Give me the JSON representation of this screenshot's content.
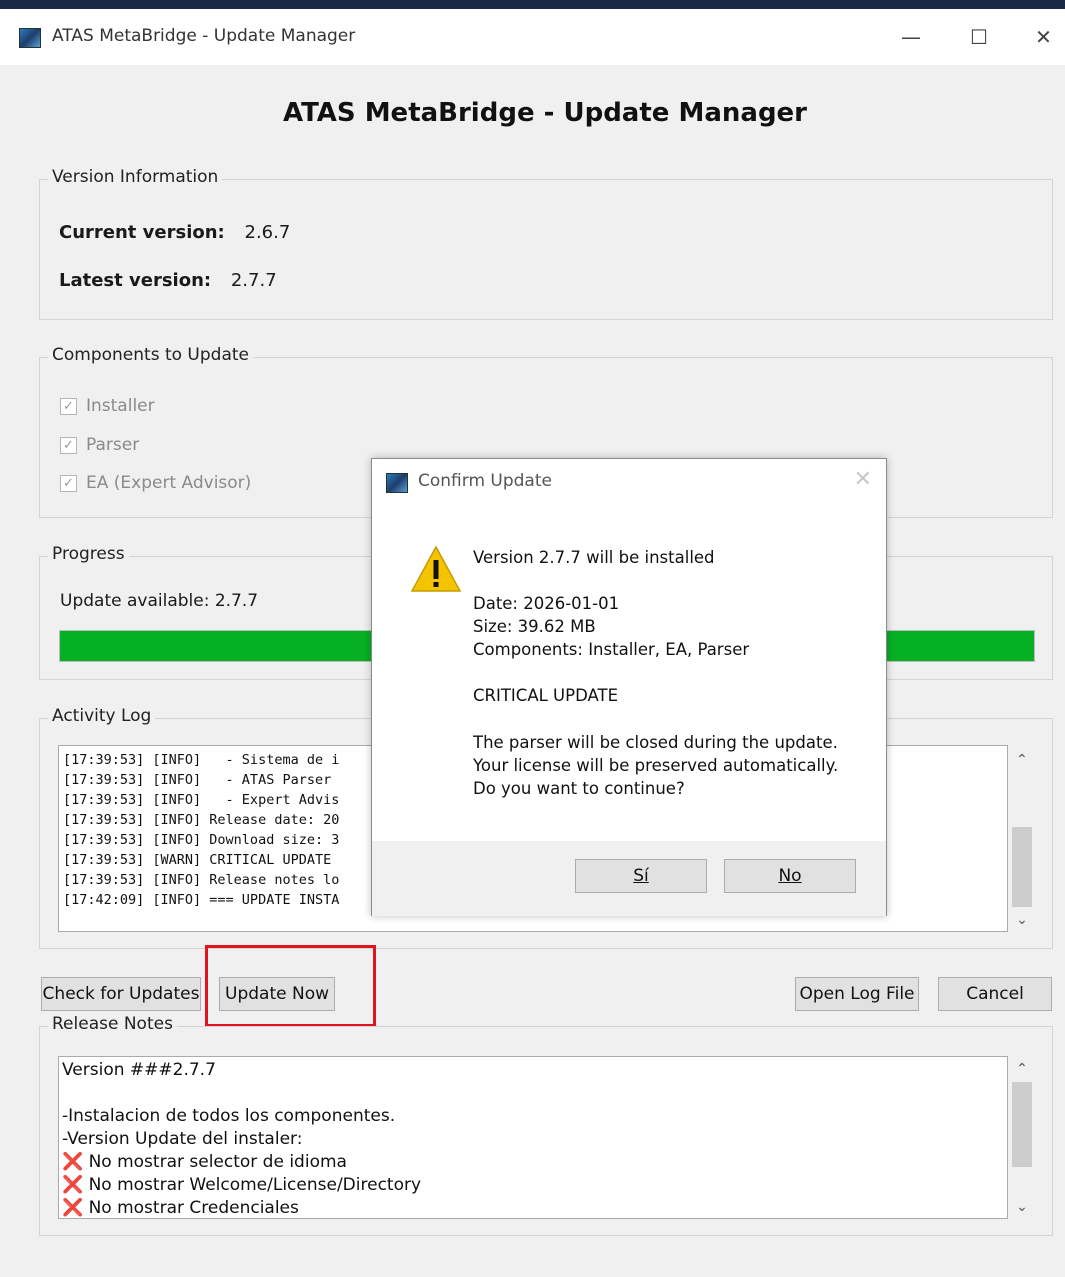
{
  "window": {
    "title": "ATAS MetaBridge - Update Manager",
    "minimize_glyph": "—",
    "maximize_glyph": "☐",
    "close_glyph": "✕"
  },
  "main_title": "ATAS MetaBridge - Update Manager",
  "version_info": {
    "group_label": "Version Information",
    "current_label": "Current version:",
    "current_value": "2.6.7",
    "latest_label": "Latest version:",
    "latest_value": "2.7.7"
  },
  "components": {
    "group_label": "Components to Update",
    "items": [
      {
        "label": "Installer",
        "checked": true
      },
      {
        "label": "Parser",
        "checked": true
      },
      {
        "label": "EA (Expert Advisor)",
        "checked": true
      }
    ]
  },
  "progress": {
    "group_label": "Progress",
    "status_text": "Update available: 2.7.7",
    "fraction": 1.0,
    "bar_color": "#06b025"
  },
  "activity_log": {
    "group_label": "Activity Log",
    "lines": [
      "[17:39:53] [INFO]   - Sistema de i",
      "[17:39:53] [INFO]   - ATAS Parser ",
      "[17:39:53] [INFO]   - Expert Advis",
      "[17:39:53] [INFO] Release date: 20",
      "[17:39:53] [INFO] Download size: 3",
      "[17:39:53] [WARN] CRITICAL UPDATE ",
      "[17:39:53] [INFO] Release notes lo",
      "[17:42:09] [INFO] === UPDATE INSTA"
    ]
  },
  "buttons": {
    "check_updates": "Check for Updates",
    "update_now": "Update Now",
    "open_log": "Open Log File",
    "cancel": "Cancel"
  },
  "release_notes": {
    "group_label": "Release Notes",
    "lines": [
      "Version ###2.7.7",
      "",
      "-Instalacion de todos los componentes.",
      "-Version Update del instaler:",
      "❌ No mostrar selector de idioma",
      "❌ No mostrar Welcome/License/Directory",
      "❌ No mostrar Credenciales"
    ]
  },
  "dialog": {
    "title": "Confirm Update",
    "close_glyph": "✕",
    "headline": "Version 2.7.7 will be installed",
    "date": "Date: 2026-01-01",
    "size": "Size: 39.62 MB",
    "components": "Components: Installer, EA, Parser",
    "critical": "CRITICAL UPDATE",
    "msg1": "The parser will be closed during the update.",
    "msg2": "Your license will be preserved automatically.",
    "msg3": "Do you want to continue?",
    "yes_label": "Sí",
    "no_label": "No"
  },
  "scroll_glyphs": {
    "up": "⌃",
    "down": "⌄"
  }
}
